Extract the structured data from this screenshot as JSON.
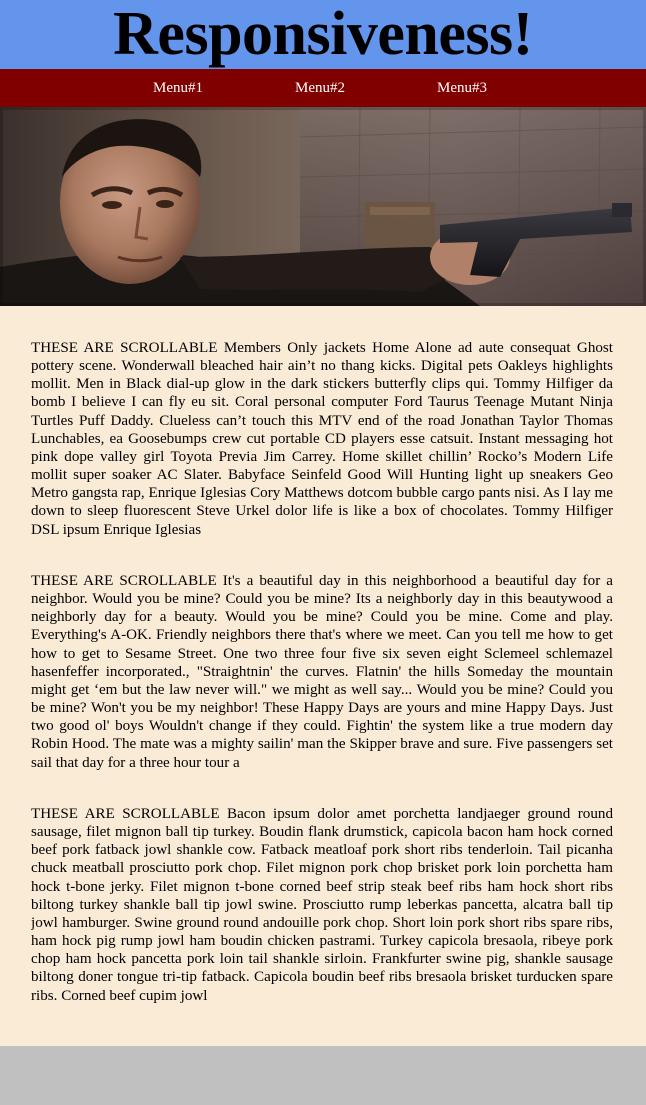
{
  "header": {
    "title": "Responsiveness!"
  },
  "nav": {
    "items": [
      {
        "label": "Menu#1"
      },
      {
        "label": "Menu#2"
      },
      {
        "label": "Menu#3"
      }
    ]
  },
  "colors": {
    "header_bg": "#6495ed",
    "nav_bg": "#800000",
    "content_bg": "#faebd7",
    "page_bg": "#c0c0c0"
  },
  "content": {
    "paragraphs": [
      {
        "text": "THESE ARE SCROLLABLE Members Only jackets Home Alone ad aute consequat Ghost pottery scene. Wonderwall bleached hair ain’t no thang kicks. Digital pets Oakleys highlights mollit. Men in Black dial-up glow in the dark stickers butterfly clips qui. Tommy Hilfiger da bomb I believe I can fly eu sit. Coral personal computer Ford Taurus Teenage Mutant Ninja Turtles Puff Daddy. Clueless can’t touch this MTV end of the road Jonathan Taylor Thomas Lunchables, ea Goosebumps crew cut portable CD players esse catsuit. Instant messaging hot pink dope valley girl Toyota Previa Jim Carrey. Home skillet chillin’ Rocko’s Modern Life mollit super soaker AC Slater. Babyface Seinfeld Good Will Hunting light up sneakers Geo Metro gangsta rap, Enrique Iglesias Cory Matthews dotcom bubble cargo pants nisi. As I lay me down to sleep fluorescent Steve Urkel dolor life is like a box of chocolates. Tommy Hilfiger DSL ipsum Enrique Iglesias"
      },
      {
        "text": "THESE ARE SCROLLABLE It's a beautiful day in this neighborhood a beautiful day for a neighbor. Would you be mine? Could you be mine? Its a neighborly day in this beautywood a neighborly day for a beauty. Would you be mine? Could you be mine. Come and play. Everything's A-OK. Friendly neighbors there that's where we meet. Can you tell me how to get how to get to Sesame Street. One two three four five six seven eight Sclemeel schlemazel hasenfeffer incorporated., \"Straightnin' the curves. Flatnin' the hills Someday the mountain might get ‘em but the law never will.\" we might as well say... Would you be mine? Could you be mine? Won't you be my neighbor! These Happy Days are yours and mine Happy Days. Just two good ol' boys Wouldn't change if they could. Fightin' the system like a true modern day Robin Hood. The mate was a mighty sailin' man the Skipper brave and sure. Five passengers set sail that day for a three hour tour a"
      },
      {
        "text": "THESE ARE SCROLLABLE Bacon ipsum dolor amet porchetta landjaeger ground round sausage, filet mignon ball tip turkey. Boudin flank drumstick, capicola bacon ham hock corned beef pork fatback jowl shankle cow. Fatback meatloaf pork short ribs tenderloin. Tail picanha chuck meatball prosciutto pork chop. Filet mignon pork chop brisket pork loin porchetta ham hock t-bone jerky. Filet mignon t-bone corned beef strip steak beef ribs ham hock short ribs biltong turkey shankle ball tip jowl swine. Prosciutto rump leberkas pancetta, alcatra ball tip jowl hamburger. Swine ground round andouille pork chop. Short loin pork short ribs spare ribs, ham hock pig rump jowl ham boudin chicken pastrami. Turkey capicola bresaola, ribeye pork chop ham hock pancetta pork loin tail shankle sirloin. Frankfurter swine pig, shankle sausage biltong doner tongue tri-tip fatback. Capicola boudin beef ribs bresaola brisket turducken spare ribs. Corned beef cupim jowl"
      }
    ]
  }
}
